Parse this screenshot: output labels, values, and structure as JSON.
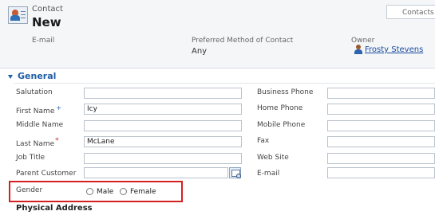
{
  "header": {
    "entity_type": "Contact",
    "record_title": "New",
    "form_selector": "Contacts",
    "email_label": "E-mail",
    "preferred_method_label": "Preferred Method of Contact",
    "preferred_method_value": "Any",
    "owner_label": "Owner",
    "owner_value": "Frosty Stevens",
    "icon": "contact-entity-icon"
  },
  "general": {
    "title": "General",
    "left_fields": [
      {
        "label": "Salutation",
        "value": ""
      },
      {
        "label": "First Name",
        "value": "Icy"
      },
      {
        "label": "Middle Name",
        "value": ""
      },
      {
        "label": "Last Name",
        "value": "McLane"
      },
      {
        "label": "Job Title",
        "value": ""
      },
      {
        "label": "Parent Customer",
        "value": ""
      }
    ],
    "right_fields": [
      {
        "label": "Business Phone",
        "value": ""
      },
      {
        "label": "Home Phone",
        "value": ""
      },
      {
        "label": "Mobile Phone",
        "value": ""
      },
      {
        "label": "Fax",
        "value": ""
      },
      {
        "label": "Web Site",
        "value": ""
      },
      {
        "label": "E-mail",
        "value": ""
      }
    ],
    "required_plus": "+",
    "required_star": "*",
    "gender": {
      "label": "Gender",
      "options": [
        "Male",
        "Female"
      ]
    },
    "highlight_color": "#d61f1f"
  },
  "physical_address": {
    "title": "Physical Address"
  },
  "colors": {
    "section_accent": "#1f5ea8",
    "link": "#1a4a9e",
    "header_bg": "#f4f6f8"
  }
}
